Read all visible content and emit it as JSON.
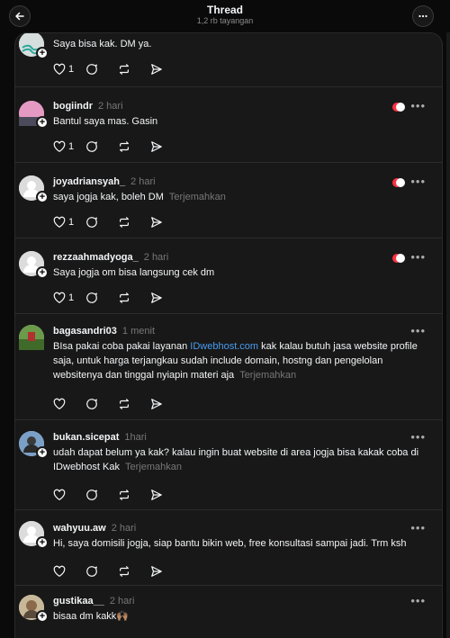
{
  "header": {
    "title": "Thread",
    "subtitle": "1,2 rb tayangan"
  },
  "posts": [
    {
      "username": "",
      "time": "",
      "text": "Saya bisa kak. DM ya.",
      "likes": "1",
      "translate": ""
    },
    {
      "username": "bogiindr",
      "time": "2 hari",
      "text": "Bantul saya mas. Gasin",
      "likes": "1",
      "translate": ""
    },
    {
      "username": "joyadriansyah_",
      "time": "2 hari",
      "text": "saya jogja kak, boleh DM",
      "likes": "1",
      "translate": "Terjemahkan"
    },
    {
      "username": "rezzaahmadyoga_",
      "time": "2 hari",
      "text": "Saya jogja om bisa langsung cek dm",
      "likes": "1",
      "translate": ""
    },
    {
      "username": "bagasandri03",
      "time": "1 menit",
      "text_pre": "BIsa pakai coba pakai layanan ",
      "link": "IDwebhost.com",
      "text_post": " kak kalau butuh jasa website profile saja, untuk harga terjangkau sudah include domain, hostng dan pengelolan websitenya dan tinggal nyiapin materi aja",
      "translate": "Terjemahkan"
    },
    {
      "username": "bukan.sicepat",
      "time": "1hari",
      "text": "udah dapat belum ya kak? kalau ingin buat website di area jogja bisa kakak coba di IDwebhost Kak",
      "translate": "Terjemahkan"
    },
    {
      "username": "wahyuu.aw",
      "time": "2 hari",
      "text": "Hi, saya domisili jogja, siap bantu bikin web, free konsultasi sampai jadi. Trm ksh",
      "translate": ""
    },
    {
      "username": "gustikaa__",
      "time": "2 hari",
      "text": "bisaa dm kakk🙌🏽",
      "translate": ""
    }
  ],
  "colors": {
    "background": "#0a0a0a",
    "card": "#181818",
    "link": "#4a9cf0",
    "muted": "#777777",
    "heart": "#ff3040"
  }
}
